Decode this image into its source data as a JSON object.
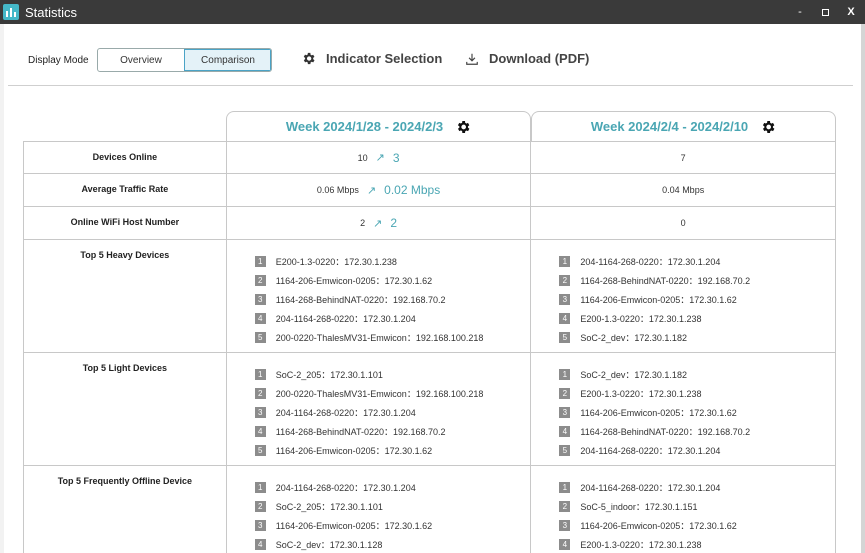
{
  "window": {
    "title": "Statistics",
    "minimize": "-",
    "close": "X"
  },
  "toolbar": {
    "display_mode_label": "Display Mode",
    "modes": [
      {
        "label": "Overview",
        "active": false
      },
      {
        "label": "Comparison",
        "active": true
      }
    ],
    "indicator_selection": "Indicator Selection",
    "download": "Download (PDF)"
  },
  "columns": [
    {
      "header": "Week 2024/1/28 - 2024/2/3"
    },
    {
      "header": "Week 2024/2/4 - 2024/2/10"
    }
  ],
  "rows": [
    {
      "label": "Devices Online",
      "c1_value": "10",
      "c1_trend": "3",
      "c2_value": "7"
    },
    {
      "label": "Average Traffic Rate",
      "c1_value": "0.06 Mbps",
      "c1_trend": "0.02 Mbps",
      "c2_value": "0.04 Mbps"
    },
    {
      "label": "Online WiFi Host Number",
      "c1_value": "2",
      "c1_trend": "2",
      "c2_value": "0"
    }
  ],
  "lists": [
    {
      "label": "Top 5 Heavy Devices",
      "c1": [
        "E200-1.3-0220：172.30.1.238",
        "1164-206-Emwicon-0205：172.30.1.62",
        "1164-268-BehindNAT-0220：192.168.70.2",
        "204-1164-268-0220：172.30.1.204",
        "200-0220-ThalesMV31-Emwicon：192.168.100.218"
      ],
      "c2": [
        "204-1164-268-0220：172.30.1.204",
        "1164-268-BehindNAT-0220：192.168.70.2",
        "1164-206-Emwicon-0205：172.30.1.62",
        "E200-1.3-0220：172.30.1.238",
        "SoC-2_dev：172.30.1.182"
      ]
    },
    {
      "label": "Top 5 Light Devices",
      "c1": [
        "SoC-2_205：172.30.1.101",
        "200-0220-ThalesMV31-Emwicon：192.168.100.218",
        "204-1164-268-0220：172.30.1.204",
        "1164-268-BehindNAT-0220：192.168.70.2",
        "1164-206-Emwicon-0205：172.30.1.62"
      ],
      "c2": [
        "SoC-2_dev：172.30.1.182",
        "E200-1.3-0220：172.30.1.238",
        "1164-206-Emwicon-0205：172.30.1.62",
        "1164-268-BehindNAT-0220：192.168.70.2",
        "204-1164-268-0220：172.30.1.204"
      ]
    },
    {
      "label": "Top 5 Frequently Offline Device",
      "c1": [
        "204-1164-268-0220：172.30.1.204",
        "SoC-2_205：172.30.1.101",
        "1164-206-Emwicon-0205：172.30.1.62",
        "SoC-2_dev：172.30.1.128"
      ],
      "c2": [
        "204-1164-268-0220：172.30.1.204",
        "SoC-5_indoor：172.30.1.151",
        "1164-206-Emwicon-0205：172.30.1.62",
        "E200-1.3-0220：172.30.1.238"
      ]
    }
  ],
  "colors": {
    "accent": "#4aa6b3",
    "titlebar": "#3a3a3a",
    "badge": "#8c8c8c"
  },
  "icons": {
    "app": "bar-chart-icon",
    "settings": "gear-icon",
    "download": "download-icon",
    "trend": "trending-up-icon"
  }
}
